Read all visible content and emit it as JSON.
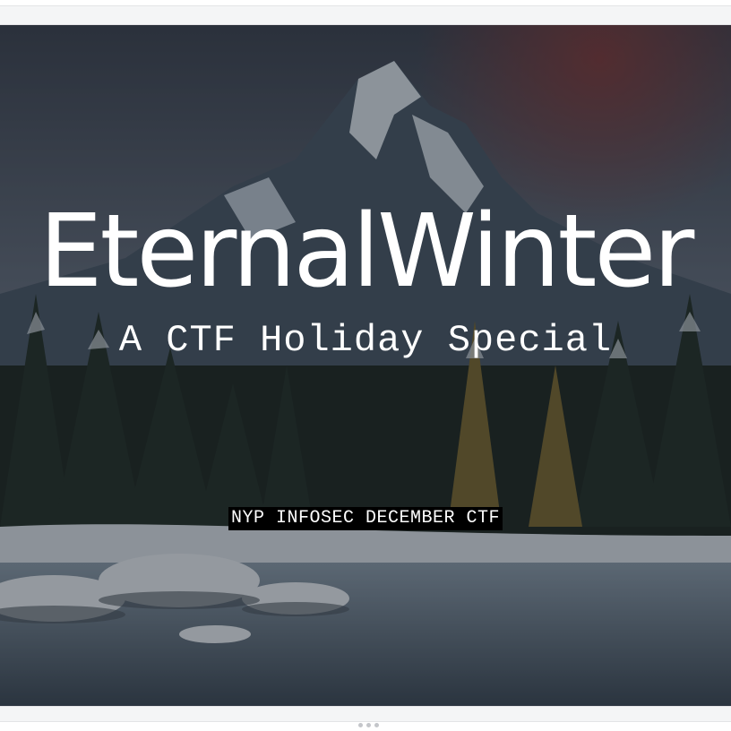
{
  "slide": {
    "title": "EternalWinter",
    "subtitle": "A CTF Holiday Special",
    "tagline": "NYP INFOSEC DECEMBER CTF"
  },
  "colors": {
    "text": "#ffffff",
    "tagline_bg": "#000000",
    "sky": "#3a4352",
    "snow": "#e8edf2",
    "pine_dark": "#1f2a26",
    "pine_gold": "#8a7a3a",
    "water": "#5a6c7c"
  },
  "icons": {
    "more_handle": "more-dots-icon"
  }
}
